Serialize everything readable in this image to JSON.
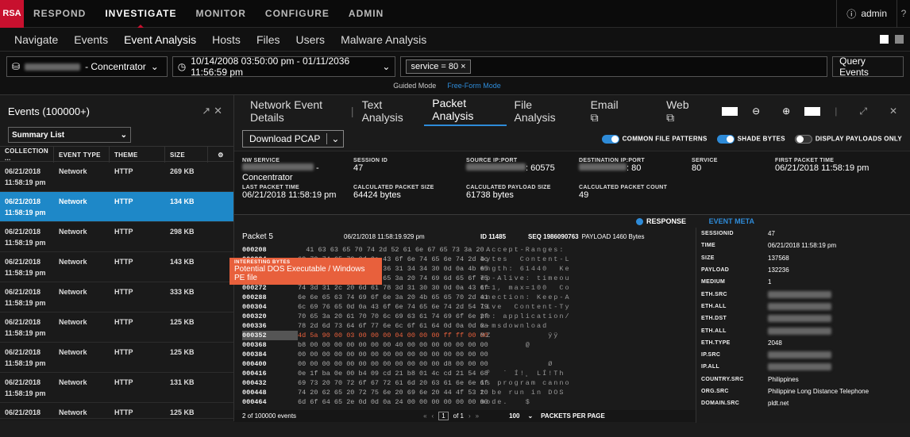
{
  "topbar": {
    "logo": "RSA",
    "nav": [
      "RESPOND",
      "INVESTIGATE",
      "MONITOR",
      "CONFIGURE",
      "ADMIN"
    ],
    "active": "INVESTIGATE",
    "user": "admin"
  },
  "subnav": {
    "items": [
      "Navigate",
      "Events",
      "Event Analysis",
      "Hosts",
      "Files",
      "Users",
      "Malware Analysis"
    ],
    "active": "Event Analysis"
  },
  "query": {
    "service_suffix": "- Concentrator",
    "time_range": "10/14/2008 03:50:00 pm - 01/11/2036 11:56:59 pm",
    "filter_pill": "service = 80",
    "button": "Query Events",
    "modes": [
      "Guided Mode",
      "Free-Form Mode"
    ]
  },
  "events_panel": {
    "title": "Events (100000+)",
    "view_select": "Summary List",
    "columns": [
      "COLLECTION ...",
      "EVENT TYPE",
      "THEME",
      "SIZE"
    ],
    "rows": [
      {
        "date": "06/21/2018",
        "time": "11:58:19 pm",
        "type": "Network",
        "theme": "HTTP",
        "size": "269 KB"
      },
      {
        "date": "06/21/2018",
        "time": "11:58:19 pm",
        "type": "Network",
        "theme": "HTTP",
        "size": "134 KB"
      },
      {
        "date": "06/21/2018",
        "time": "11:58:19 pm",
        "type": "Network",
        "theme": "HTTP",
        "size": "298 KB"
      },
      {
        "date": "06/21/2018",
        "time": "11:58:19 pm",
        "type": "Network",
        "theme": "HTTP",
        "size": "143 KB"
      },
      {
        "date": "06/21/2018",
        "time": "11:58:19 pm",
        "type": "Network",
        "theme": "HTTP",
        "size": "333 KB"
      },
      {
        "date": "06/21/2018",
        "time": "11:58:19 pm",
        "type": "Network",
        "theme": "HTTP",
        "size": "125 KB"
      },
      {
        "date": "06/21/2018",
        "time": "11:58:19 pm",
        "type": "Network",
        "theme": "HTTP",
        "size": "125 KB"
      },
      {
        "date": "06/21/2018",
        "time": "11:58:19 pm",
        "type": "Network",
        "theme": "HTTP",
        "size": "131 KB"
      },
      {
        "date": "06/21/2018",
        "time": "",
        "type": "Network",
        "theme": "HTTP",
        "size": "125 KB"
      }
    ],
    "footer": "2 of 100000 events"
  },
  "detail_tabs": {
    "tabs": [
      "Network Event Details",
      "Text Analysis",
      "Packet Analysis",
      "File Analysis",
      "Email",
      "Web"
    ],
    "active": "Packet Analysis"
  },
  "toolbar": {
    "download": "Download PCAP",
    "toggles": [
      "COMMON FILE PATTERNS",
      "SHADE BYTES",
      "DISPLAY PAYLOADS ONLY"
    ]
  },
  "summary": {
    "nw_service_label": "NW SERVICE",
    "nw_service_value": "Concentrator",
    "session_label": "SESSION ID",
    "session_value": "47",
    "src_label": "SOURCE IP:PORT",
    "src_value": ": 60575",
    "dst_label": "DESTINATION IP:PORT",
    "dst_value": ": 80",
    "service_label": "SERVICE",
    "service_value": "80",
    "first_label": "FIRST PACKET TIME",
    "first_value": "06/21/2018 11:58:19 pm",
    "last_label": "LAST PACKET TIME",
    "last_value": "06/21/2018 11:58:19 pm",
    "calc_size_label": "CALCULATED PACKET SIZE",
    "calc_size_value": "64424 bytes",
    "calc_payload_label": "CALCULATED PAYLOAD SIZE",
    "calc_payload_value": "61738 bytes",
    "calc_count_label": "CALCULATED PACKET COUNT",
    "calc_count_value": "49"
  },
  "packet": {
    "response": "RESPONSE",
    "event_meta": "EVENT META",
    "name": "Packet 5",
    "time": "06/21/2018 11:58:19.929 pm",
    "id": "ID 11485",
    "seq": "SEQ 1986090763",
    "payload": "PAYLOAD 1460 Bytes",
    "tooltip_title": "INTERESTING BYTES",
    "tooltip_text": "Potential DOS Executable / Windows PE file",
    "rows": [
      {
        "off": "000208",
        "bytes": "  41 63 63 65 70 74 2d 52 61 6e 67 65 73 3a 20",
        "asc": " Accept-Ranges: "
      },
      {
        "off": "000224",
        "bytes": "62 79 74 65 73 0d 0a 43 6f 6e 74 65 6e 74 2d 4c",
        "asc": "bytes  Content-L"
      },
      {
        "off": "000240",
        "bytes": "65 6e 67 74 68 3a 20 36 31 34 34 30 0d 0a 4b 65",
        "asc": "ength: 61440  Ke"
      },
      {
        "off": "000256",
        "bytes": "65 70 2d 41 6c 69 76 65 3a 20 74 69 6d 65 6f 75",
        "asc": "ep-Alive: timeou"
      },
      {
        "off": "000272",
        "bytes": "74 3d 31 2c 20 6d 61 78 3d 31 30 30 0d 0a 43 6f",
        "asc": "t=1, max=100  Co"
      },
      {
        "off": "000288",
        "bytes": "6e 6e 65 63 74 69 6f 6e 3a 20 4b 65 65 70 2d 41",
        "asc": "nnection: Keep-A"
      },
      {
        "off": "000304",
        "bytes": "6c 69 76 65 0d 0a 43 6f 6e 74 65 6e 74 2d 54 79",
        "asc": "live  Content-Ty"
      },
      {
        "off": "000320",
        "bytes": "70 65 3a 20 61 70 70 6c 69 63 61 74 69 6f 6e 2f",
        "asc": "pe: application/"
      },
      {
        "off": "000336",
        "bytes": "78 2d 6d 73 64 6f 77 6e 6c 6f 61 64 0d 0a 0d 0a",
        "asc": "x-msdownload    "
      },
      {
        "off": "000352",
        "bytes": "4d 5a 90 00 03 00 00 00 04 00 00 00 ff ff 00 00",
        "asc": "MZ          ÿÿ  "
      },
      {
        "off": "000368",
        "bytes": "b8 00 00 00 00 00 00 00 40 00 00 00 00 00 00 00",
        "asc": ".       @       "
      },
      {
        "off": "000384",
        "bytes": "00 00 00 00 00 00 00 00 00 00 00 00 00 00 00 00",
        "asc": "                "
      },
      {
        "off": "000400",
        "bytes": "00 00 00 00 00 00 00 00 00 00 00 00 d8 00 00 00",
        "asc": "            Ø   "
      },
      {
        "off": "000416",
        "bytes": "0e 1f ba 0e 00 b4 09 cd 21 b8 01 4c cd 21 54 68",
        "asc": " º  ´ Í!¸ LÍ!Th "
      },
      {
        "off": "000432",
        "bytes": "69 73 20 70 72 6f 67 72 61 6d 20 63 61 6e 6e 6f",
        "asc": "is program canno"
      },
      {
        "off": "000448",
        "bytes": "74 20 62 65 20 72 75 6e 20 69 6e 20 44 4f 53 20",
        "asc": "t be run in DOS "
      },
      {
        "off": "000464",
        "bytes": "6d 6f 64 65 2e 0d 0d 0a 24 00 00 00 00 00 00 00",
        "asc": "mode.   $       "
      }
    ]
  },
  "event_meta": [
    {
      "k": "SESSIONID",
      "v": "47"
    },
    {
      "k": "TIME",
      "v": "06/21/2018 11:58:19 pm"
    },
    {
      "k": "SIZE",
      "v": "137568"
    },
    {
      "k": "PAYLOAD",
      "v": "132236"
    },
    {
      "k": "MEDIUM",
      "v": "1"
    },
    {
      "k": "ETH.SRC",
      "v": ""
    },
    {
      "k": "ETH.ALL",
      "v": ""
    },
    {
      "k": "ETH.DST",
      "v": ""
    },
    {
      "k": "ETH.ALL",
      "v": ""
    },
    {
      "k": "ETH.TYPE",
      "v": "2048"
    },
    {
      "k": "IP.SRC",
      "v": ""
    },
    {
      "k": "IP.ALL",
      "v": ""
    },
    {
      "k": "COUNTRY.SRC",
      "v": "Philippines"
    },
    {
      "k": "ORG.SRC",
      "v": "Philippine Long Distance Telephone"
    },
    {
      "k": "DOMAIN.SRC",
      "v": "pldt.net"
    }
  ],
  "pager": {
    "page": "1",
    "of": "of 1",
    "per_page": "100",
    "per_page_label": "PACKETS PER PAGE"
  }
}
